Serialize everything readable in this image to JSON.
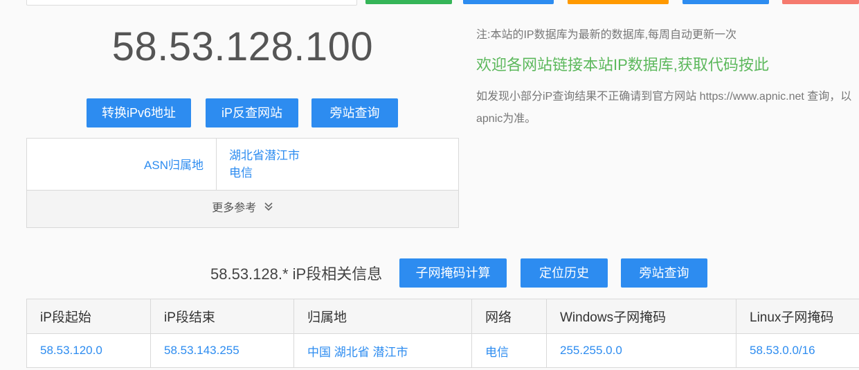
{
  "top_buttons": {
    "colors": [
      "#35b558",
      "#2d8cf0",
      "#ff9900",
      "#2d8cf0",
      "#f57a6e"
    ]
  },
  "ip": {
    "address": "58.53.128.100"
  },
  "actions": {
    "ipv6_label": "转换iPv6地址",
    "reverse_label": "iP反查网站",
    "side_label": "旁站查询"
  },
  "info": {
    "asn_label": "ASN归属地",
    "asn_region": "湖北省潜江市",
    "asn_isp": "电信",
    "more_label": "更多参考"
  },
  "notes": {
    "db_note": "注:本站的IP数据库为最新的数据库,每周自动更新一次",
    "link_promo": "欢迎各网站链接本站IP数据库,获取代码按此",
    "apnic_note": "如发现小部分iP查询结果不正确请到官方网站 https://www.apnic.net 查询，以apnic为准。"
  },
  "segment": {
    "title": "58.53.128.* iP段相关信息",
    "subnet_calc_label": "子网掩码计算",
    "location_history_label": "定位历史",
    "side_label": "旁站查询",
    "headers": [
      "iP段起始",
      "iP段结束",
      "归属地",
      "网络",
      "Windows子网掩码",
      "Linux子网掩码"
    ],
    "rows": [
      [
        "58.53.120.0",
        "58.53.143.255",
        "中国 湖北省 潜江市",
        "电信",
        "255.255.0.0",
        "58.53.0.0/16"
      ]
    ]
  },
  "colors": {
    "primary": "#2d8cf0",
    "promo_green": "#5cb85c",
    "muted_text": "#777777"
  }
}
